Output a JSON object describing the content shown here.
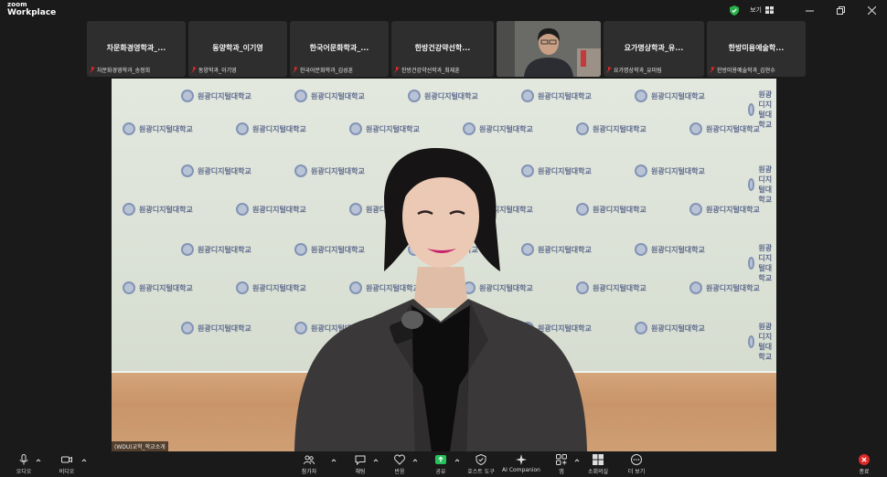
{
  "titlebar": {
    "brand_small": "zoom",
    "brand_large": "Workplace",
    "view_label": "보기"
  },
  "thumbnails": [
    {
      "title": "차문화경영학과_...",
      "footer": "차문화경영학과_송정희"
    },
    {
      "title": "동양학과_이기영",
      "footer": "동양학과_이기영"
    },
    {
      "title": "한국어문화학과_...",
      "footer": "한국어문화학과_김성훈"
    },
    {
      "title": "한방건강약선학...",
      "footer": "한방건강약선학과_최재훈"
    },
    {
      "title": "",
      "footer": ""
    },
    {
      "title": "요가명상학과_유...",
      "footer": "요가명상학과_유미림"
    },
    {
      "title": "한방미용예술학...",
      "footer": "한방미용예술학과_김현수"
    }
  ],
  "main_video": {
    "name_tag": "(WDU)교학_학교소개",
    "wall_text": "원광디지털대학교"
  },
  "toolbar": {
    "audio": "오디오",
    "video": "비디오",
    "participants": "참가자",
    "chat": "채팅",
    "react": "반응",
    "share": "공유",
    "host_tools": "호스트 도구",
    "ai_companion": "AI Companion",
    "apps": "앱",
    "rooms": "소회의실",
    "more": "더 보기",
    "end": "종료"
  },
  "colors": {
    "background": "#1a1a1a",
    "tile": "#2e2e2e",
    "share_green": "#26c15b",
    "end_red": "#e02828",
    "shield_green": "#2bb24c"
  }
}
